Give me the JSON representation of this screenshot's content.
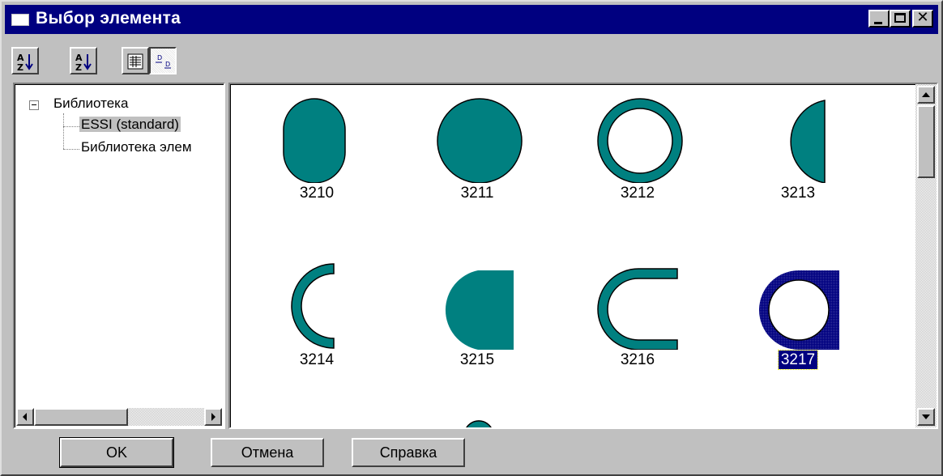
{
  "window": {
    "title": "Выбор элемента",
    "controls": [
      "minimize",
      "maximize",
      "close"
    ],
    "close_glyph": "✕"
  },
  "toolbar": {
    "buttons": [
      {
        "icon": "sort-ascending-icon"
      },
      {
        "icon": "sort-descending-icon"
      },
      {
        "icon": "list-view-icon"
      },
      {
        "icon": "icon-view-icon",
        "pressed": true
      }
    ]
  },
  "tree": {
    "root": "Библиотека",
    "children": [
      "ESSI (standard)",
      "Библиотека элем"
    ],
    "selected": "ESSI (standard)"
  },
  "gallery": {
    "fill_color": "#008080",
    "selected_color": "#000080",
    "items": [
      {
        "label": "3210",
        "shape": "stadium"
      },
      {
        "label": "3211",
        "shape": "circle"
      },
      {
        "label": "3212",
        "shape": "ring"
      },
      {
        "label": "3213",
        "shape": "half-disc"
      },
      {
        "label": "3214",
        "shape": "arc"
      },
      {
        "label": "3215",
        "shape": "d-shape"
      },
      {
        "label": "3216",
        "shape": "u-shape"
      },
      {
        "label": "3217",
        "shape": "square-ring",
        "selected": true
      }
    ]
  },
  "buttons": {
    "ok": "OK",
    "cancel": "Отмена",
    "help": "Справка"
  }
}
